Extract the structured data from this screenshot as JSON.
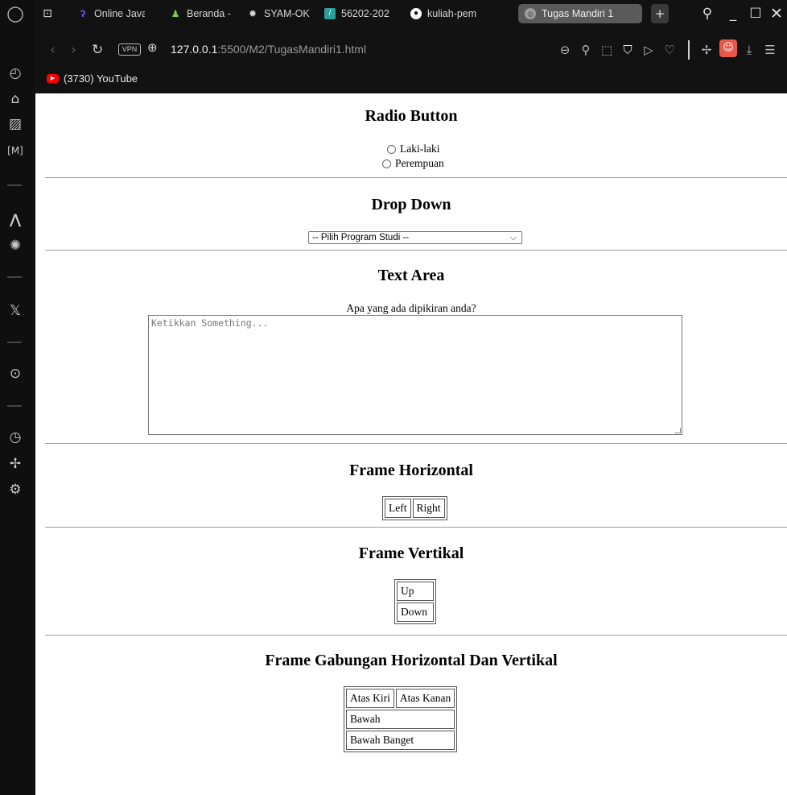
{
  "tabs": [
    {
      "label": "Online Java",
      "icon": "replit-icon",
      "color": "#7c5cff"
    },
    {
      "label": "Beranda - ",
      "icon": "chess-pawn-icon",
      "color": "#8bc34a"
    },
    {
      "label": "SYAM-OK ",
      "icon": "gear-icon",
      "color": "#d9d9d9"
    },
    {
      "label": "56202-202",
      "icon": "document-icon",
      "color": "#2aa198"
    },
    {
      "label": "kuliah-pem",
      "icon": "github-icon",
      "color": "#ffffff"
    },
    {
      "label": "Tugas Mandiri 1",
      "icon": "globe-icon",
      "color": "#9e9e9e",
      "active": true
    }
  ],
  "address": {
    "vpn_label": "VPN",
    "host": "127.0.0.1",
    "path": ":5500/M2/TugasMandiri1.html"
  },
  "bookmarks": [
    {
      "label": "(3730) YouTube",
      "icon": "youtube-icon"
    }
  ],
  "page": {
    "radio_section": {
      "title": "Radio Button",
      "options": [
        "Laki-laki",
        "Perempuan"
      ]
    },
    "dropdown_section": {
      "title": "Drop Down",
      "selected": "-- Pilih Program Studi --"
    },
    "textarea_section": {
      "title": "Text Area",
      "label": "Apa yang ada dipikiran anda?",
      "placeholder": "Ketikkan Something..."
    },
    "frame_horizontal": {
      "title": "Frame Horizontal",
      "cells": [
        "Left",
        "Right"
      ]
    },
    "frame_vertical": {
      "title": "Frame Vertikal",
      "cells": [
        "Up",
        "Down"
      ]
    },
    "frame_combined": {
      "title": "Frame Gabungan Horizontal Dan Vertikal",
      "top_left": "Atas Kiri",
      "top_right": "Atas Kanan",
      "bottom": "Bawah",
      "bottom_most": "Bawah Banget"
    }
  }
}
